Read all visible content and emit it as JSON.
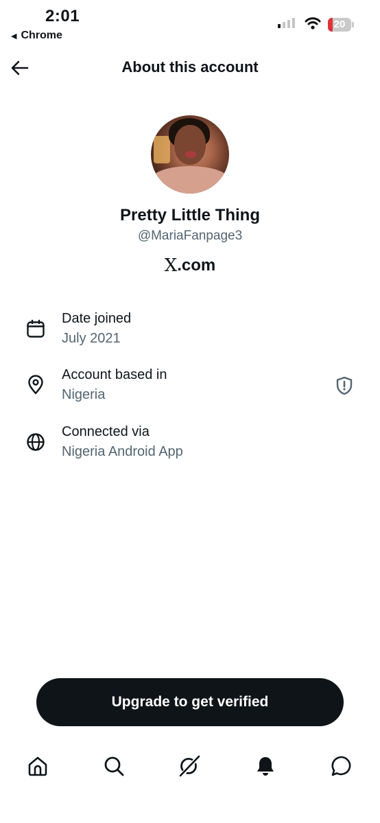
{
  "status_bar": {
    "time": "2:01",
    "back_app": "Chrome",
    "battery_level": "20",
    "battery_color": "#e0323a",
    "icons": [
      "signal-icon",
      "wifi-icon",
      "battery-icon"
    ]
  },
  "header": {
    "title": "About this account",
    "back_icon": "back-arrow-icon"
  },
  "profile": {
    "display_name": "Pretty Little Thing",
    "handle": "@MariaFanpage3",
    "source_logo": "X",
    "source_suffix": ".com"
  },
  "details": [
    {
      "icon": "calendar-icon",
      "label": "Date joined",
      "value": "July 2021"
    },
    {
      "icon": "location-pin-icon",
      "label": "Account based in",
      "value": "Nigeria",
      "badge_icon": "shield-exclamation-icon"
    },
    {
      "icon": "globe-icon",
      "label": "Connected via",
      "value": "Nigeria Android App"
    }
  ],
  "upgrade": {
    "label": "Upgrade to get verified"
  },
  "bottom_nav": [
    "home-icon",
    "search-icon",
    "grok-icon",
    "notifications-bell-icon",
    "messages-icon"
  ],
  "colors": {
    "primary_text": "#0f1419",
    "secondary_text": "#536471",
    "button_bg": "#0f1419",
    "background": "#ffffff"
  }
}
